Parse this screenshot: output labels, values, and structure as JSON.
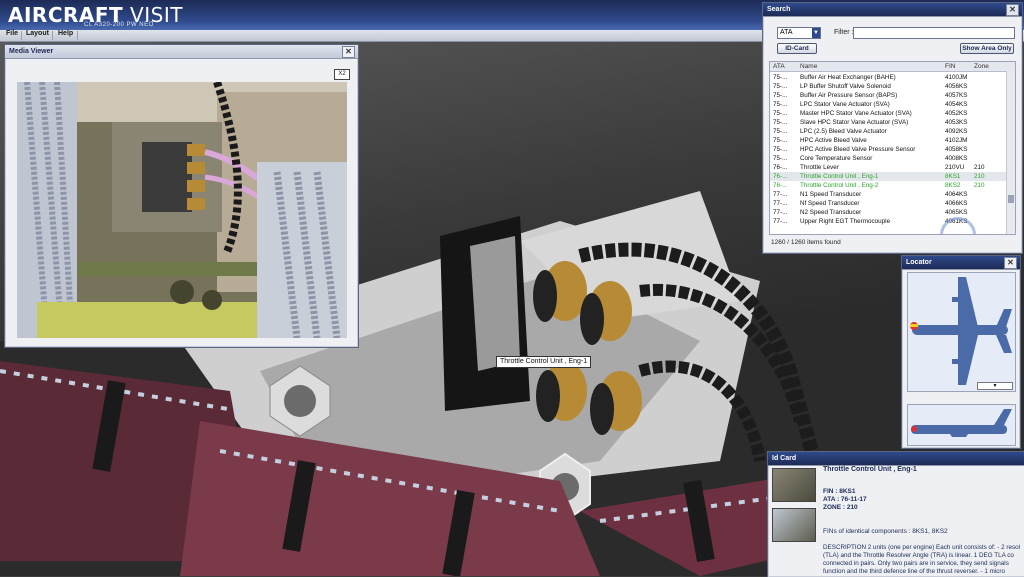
{
  "app": {
    "logo_text_1": "AIRCRAFT",
    "logo_text_2": " VISIT",
    "subtitle": "CL A320-200 PW NEO"
  },
  "menu": {
    "file": "File",
    "layout": "Layout",
    "help": "Help"
  },
  "media_viewer": {
    "title": "Media Viewer",
    "close": "✕",
    "zoom_label": "X2"
  },
  "search": {
    "title": "Search",
    "close": "✕",
    "filter_mode": "ATA",
    "filter_label": "Filter :",
    "filter_value": "",
    "id_card_button": "ID-Card",
    "show_area_button": "Show Area Only",
    "columns": [
      "ATA",
      "Name",
      "FIN",
      "Zone"
    ],
    "rows": [
      {
        "ata": "75-...",
        "name": "Buffer Air Heat Exchanger (BAHE)",
        "fin": "4100JM",
        "zone": ""
      },
      {
        "ata": "75-...",
        "name": "LP Buffer Shutoff Valve Solenoid",
        "fin": "4056KS",
        "zone": ""
      },
      {
        "ata": "75-...",
        "name": "Buffer Air Pressure Sensor (BAPS)",
        "fin": "4057KS",
        "zone": ""
      },
      {
        "ata": "75-...",
        "name": "LPC Stator Vane Actuator (SVA)",
        "fin": "4054KS",
        "zone": ""
      },
      {
        "ata": "75-...",
        "name": "Master HPC Stator Vane Actuator (SVA)",
        "fin": "4052KS",
        "zone": ""
      },
      {
        "ata": "75-...",
        "name": "Slave HPC Stator Vane Actuator (SVA)",
        "fin": "4053KS",
        "zone": ""
      },
      {
        "ata": "75-...",
        "name": "LPC (2.5) Bleed Valve Actuator",
        "fin": "4092KS",
        "zone": ""
      },
      {
        "ata": "75-...",
        "name": "HPC Active Bleed Valve",
        "fin": "4102JM",
        "zone": ""
      },
      {
        "ata": "75-...",
        "name": "HPC Active Bleed Valve Pressure Sensor",
        "fin": "4058KS",
        "zone": ""
      },
      {
        "ata": "75-...",
        "name": "Core Temperature Sensor",
        "fin": "4008KS",
        "zone": ""
      },
      {
        "ata": "76-...",
        "name": "Throttle Lever",
        "fin": "210VU",
        "zone": "210"
      },
      {
        "ata": "76-...",
        "name": "Throttle Control Unit , Eng-1",
        "fin": "8KS1",
        "zone": "210"
      },
      {
        "ata": "76-...",
        "name": "Throttle Control Unit , Eng-2",
        "fin": "8KS2",
        "zone": "210"
      },
      {
        "ata": "77-...",
        "name": "N1 Speed Transducer",
        "fin": "4064KS",
        "zone": ""
      },
      {
        "ata": "77-...",
        "name": "Nf Speed Transducer",
        "fin": "4066KS",
        "zone": ""
      },
      {
        "ata": "77-...",
        "name": "N2 Speed Transducer",
        "fin": "4065KS",
        "zone": ""
      },
      {
        "ata": "77-...",
        "name": "Upper Right EGT Thermocouple",
        "fin": "4061KS",
        "zone": ""
      }
    ],
    "status": "1260 / 1260 items found"
  },
  "locator": {
    "title": "Locator",
    "close": "✕"
  },
  "id_card": {
    "title": "Id Card",
    "component": "Throttle Control Unit , Eng-1",
    "fin": "FIN : 8KS1",
    "ata": "ATA : 76-11-17",
    "zone": "ZONE : 210",
    "identical": "FINs of identical components : 8KS1, 8KS2",
    "desc_1": "DESCRIPTION 2 units (one per engine) Each unit consists of: - 2 resol",
    "desc_2": "(TLA) and the Throttle Resolver Angle (TRA) is linear. 1 DEG TLA co",
    "desc_3": "connected in pairs. Only two pairs are in service, they send signals",
    "desc_4": "function and the third defence line of the thrust reverser. - 1 micro"
  },
  "tooltip": "Throttle Control Unit , Eng-1",
  "colors": {
    "title_bar": "#2f4a8c",
    "highlight_text": "#2aa52a"
  }
}
